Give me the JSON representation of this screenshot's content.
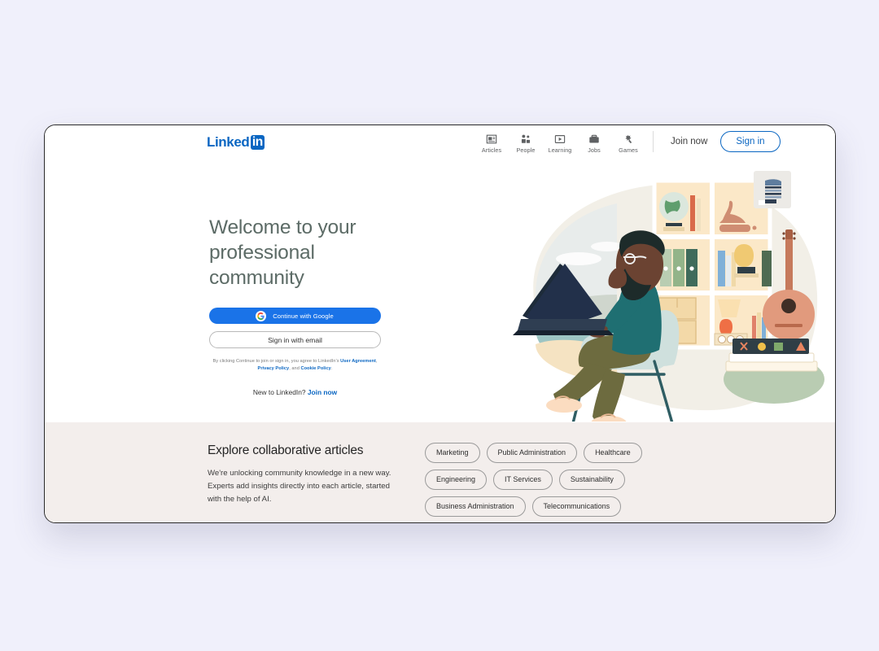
{
  "page": {
    "background_color": "#f0f0fb",
    "card_background": "#ffffff"
  },
  "nav": {
    "brand": {
      "word": "Linked",
      "box": "in",
      "color": "#0a66c2"
    },
    "items": [
      {
        "label": "Articles",
        "icon": "article-icon"
      },
      {
        "label": "People",
        "icon": "people-icon"
      },
      {
        "label": "Learning",
        "icon": "play-icon"
      },
      {
        "label": "Jobs",
        "icon": "briefcase-icon"
      },
      {
        "label": "Games",
        "icon": "puzzle-icon"
      }
    ],
    "join_now": "Join now",
    "sign_in": "Sign in"
  },
  "hero": {
    "title": "Welcome to your\nprofessional community",
    "title_color": "#5c6b66",
    "google_button": "Continue with Google",
    "google_button_color": "#1a73e8",
    "email_button": "Sign in with email",
    "legal": {
      "part1": "By clicking Continue to join or sign in, you agree to LinkedIn's ",
      "link1": "User Agreement",
      "part2": ", ",
      "link2": "Privacy Policy",
      "part3": ", and ",
      "link3": "Cookie Policy",
      "part4": "."
    },
    "new_to_text": "New to LinkedIn? ",
    "new_to_link": "Join now"
  },
  "articles": {
    "title": "Explore collaborative articles",
    "subtitle": "We're unlocking community knowledge in a new way. Experts add insights directly into each article, started with the help of AI.",
    "background_color": "#f3eeec",
    "pills": [
      {
        "label": "Marketing",
        "accent": false
      },
      {
        "label": "Public Administration",
        "accent": false
      },
      {
        "label": "Healthcare",
        "accent": false
      },
      {
        "label": "Engineering",
        "accent": false
      },
      {
        "label": "IT Services",
        "accent": false
      },
      {
        "label": "Sustainability",
        "accent": false
      },
      {
        "label": "Business Administration",
        "accent": false
      },
      {
        "label": "Telecommunications",
        "accent": false
      },
      {
        "label": "",
        "accent": false
      },
      {
        "label": "",
        "accent": true
      }
    ]
  }
}
